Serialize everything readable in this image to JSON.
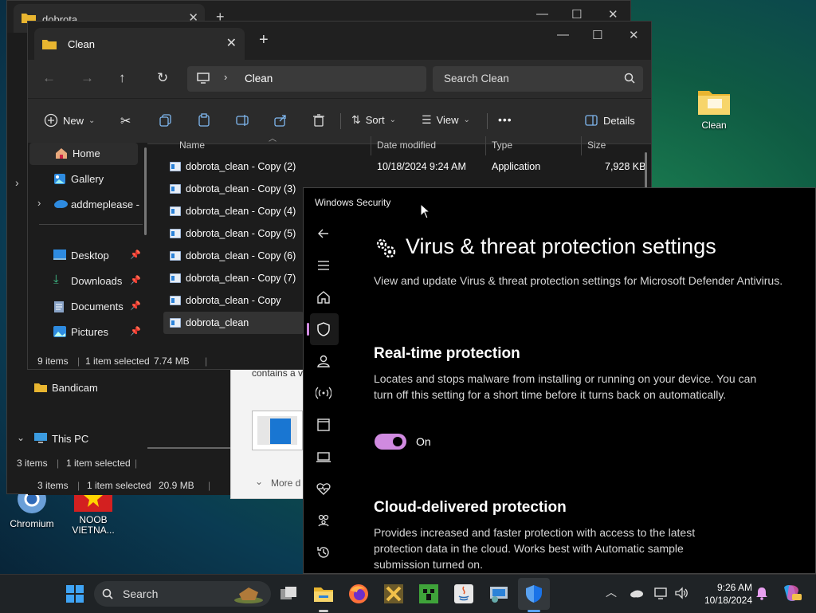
{
  "desktop": {
    "icons": [
      {
        "label": "Clean"
      },
      {
        "label": "Chromium"
      },
      {
        "label": "NOOB VIETNA..."
      },
      {
        "label": "Bandicam"
      }
    ]
  },
  "back_explorer": {
    "tab_title": "dobrota",
    "status": {
      "items": "3 items",
      "selected": "1 item selected",
      "size": ""
    },
    "status2": {
      "items": "3 items",
      "selected": "1 item selected",
      "size": "20.9 MB"
    },
    "nav": {
      "this_pc": "This PC",
      "bandicam": "Bandicam"
    }
  },
  "front_explorer": {
    "tab_title": "Clean",
    "path": "Clean",
    "search_placeholder": "Search Clean",
    "commands": {
      "new": "New",
      "sort": "Sort",
      "view": "View",
      "more": "•••",
      "details": "Details"
    },
    "nav_items": [
      {
        "label": "Home"
      },
      {
        "label": "Gallery"
      },
      {
        "label": "addmeplease - F"
      },
      {
        "label": "Desktop"
      },
      {
        "label": "Downloads"
      },
      {
        "label": "Documents"
      },
      {
        "label": "Pictures"
      }
    ],
    "columns": {
      "name": "Name",
      "date": "Date modified",
      "type": "Type",
      "size": "Size"
    },
    "files": [
      {
        "name": "dobrota_clean - Copy (2)",
        "date": "10/18/2024 9:24 AM",
        "type": "Application",
        "size": "7,928 KB"
      },
      {
        "name": "dobrota_clean - Copy (3)"
      },
      {
        "name": "dobrota_clean - Copy (4)"
      },
      {
        "name": "dobrota_clean - Copy (5)"
      },
      {
        "name": "dobrota_clean - Copy (6)"
      },
      {
        "name": "dobrota_clean - Copy (7)"
      },
      {
        "name": "dobrota_clean - Copy"
      },
      {
        "name": "dobrota_clean"
      }
    ],
    "status": {
      "items": "9 items",
      "selected": "1 item selected",
      "size": "7.74 MB"
    }
  },
  "middle_dialog": {
    "text_fragment": "contains a v",
    "more_label": "More d"
  },
  "security": {
    "window_title": "Windows Security",
    "heading": "Virus & threat protection settings",
    "intro": "View and update Virus & threat protection settings for Microsoft Defender Antivirus.",
    "realtime": {
      "title": "Real-time protection",
      "desc": "Locates and stops malware from installing or running on your device. You can turn off this setting for a short time before it turns back on automatically.",
      "toggle_label": "On",
      "toggle_on": true
    },
    "cloud": {
      "title": "Cloud-delivered protection",
      "desc": "Provides increased and faster protection with access to the latest protection data in the cloud. Works best with Automatic sample submission turned on."
    },
    "accent_color": "#d08ae0"
  },
  "taskbar": {
    "search_label": "Search",
    "time": "9:26 AM",
    "date": "10/18/2024"
  }
}
